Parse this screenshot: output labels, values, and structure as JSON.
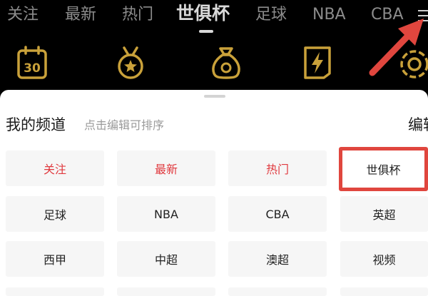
{
  "colors": {
    "accent_red": "#e0393e",
    "icon_gold": "#c9a13a",
    "arrow_red": "#e0463e"
  },
  "nav": {
    "tabs": [
      {
        "label": "关注"
      },
      {
        "label": "最新"
      },
      {
        "label": "热门"
      },
      {
        "label": "世俱杯",
        "active": true
      },
      {
        "label": "足球"
      },
      {
        "label": "NBA"
      },
      {
        "label": "CBA"
      }
    ],
    "menu_icon": "hamburger-menu-icon"
  },
  "icon_bar": {
    "items": [
      {
        "icon": "calendar-icon",
        "text": "30"
      },
      {
        "icon": "medal-icon"
      },
      {
        "icon": "money-bag-icon"
      },
      {
        "icon": "lightning-card-icon"
      },
      {
        "icon": "gear-wheel-icon"
      }
    ]
  },
  "panel": {
    "title": "我的频道",
    "hint": "点击编辑可排序",
    "edit_label": "编辑",
    "channels": [
      {
        "label": "关注",
        "red": true
      },
      {
        "label": "最新",
        "red": true
      },
      {
        "label": "热门",
        "red": true
      },
      {
        "label": "世俱杯",
        "highlight": true
      },
      {
        "label": "足球"
      },
      {
        "label": "NBA"
      },
      {
        "label": "CBA"
      },
      {
        "label": "英超"
      },
      {
        "label": "西甲"
      },
      {
        "label": "中超"
      },
      {
        "label": "澳超"
      },
      {
        "label": "视频"
      }
    ]
  }
}
